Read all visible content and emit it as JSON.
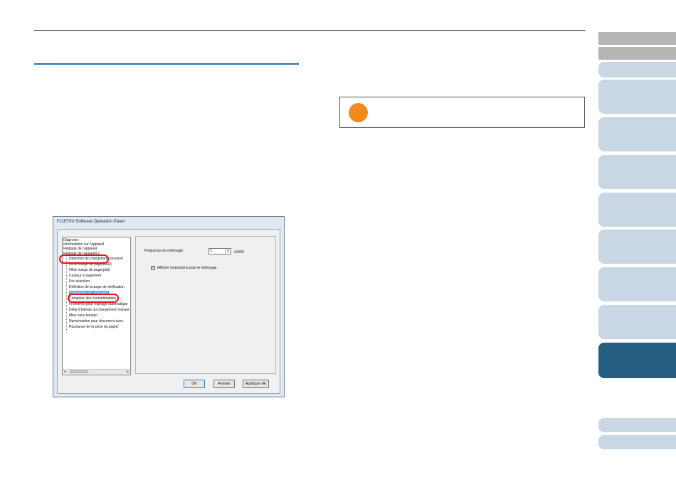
{
  "dialog": {
    "title": "FUJITSU Software Operation Panel",
    "tree": {
      "items": [
        "Diagnose",
        "Informations sur l'appareil",
        "Réglage de l'appareil",
        "Réglage de l'appareil 2"
      ],
      "subitems": [
        "Détection de chargement excessif",
        "Filtre marge de page(AAD)",
        "Filtre marge de page(plat)",
        "Couleur à supprimer",
        "Pré-sélection",
        "Définition de la page de vérification",
        "Fréquence de nettoyage",
        "Compteur des consommables",
        "Frontières pour rognage automatique",
        "Délai d'attente du chargement manuel",
        "Mise sous tension",
        "Numérisation pour document avec",
        "Puissance de la prise du papier"
      ]
    },
    "panel": {
      "frequency_label": "Fréquence de nettoyage",
      "frequency_value": "1",
      "frequency_unit": "x1000",
      "checkbox_label": "Afficher instructions pour le nettoyage",
      "checkbox_checked": true
    },
    "buttons": {
      "ok": "OK",
      "cancel": "Annuler",
      "apply": "Appliquer (A)"
    }
  },
  "colors": {
    "accent": "#255e82",
    "tab_light": "#c8d7e3",
    "tab_gray": "#b5b5b5",
    "hint_orange": "#f08a1c",
    "highlight_red": "#e8101d"
  }
}
